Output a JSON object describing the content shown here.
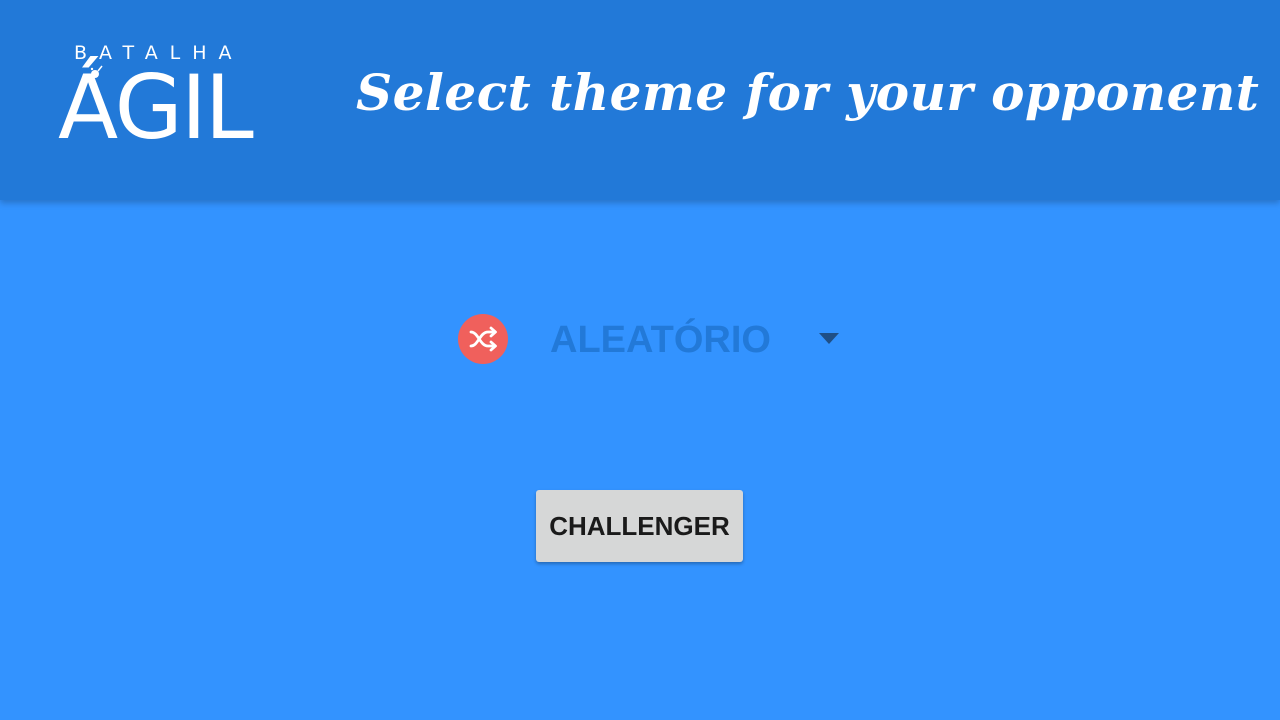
{
  "header": {
    "logo": {
      "top_text": "BATALHA",
      "main_text": "ÁGIL"
    },
    "title": "Select theme for your opponent"
  },
  "theme_select": {
    "selected_label": "ALEATÓRIO",
    "icon": "shuffle-icon",
    "icon_color": "#f0605c",
    "label_color": "#2279d8"
  },
  "actions": {
    "challenge_label": "CHALLENGER"
  },
  "colors": {
    "header_bg": "#2279d8",
    "page_bg": "#3393ff",
    "button_bg": "#d6d7d7"
  }
}
